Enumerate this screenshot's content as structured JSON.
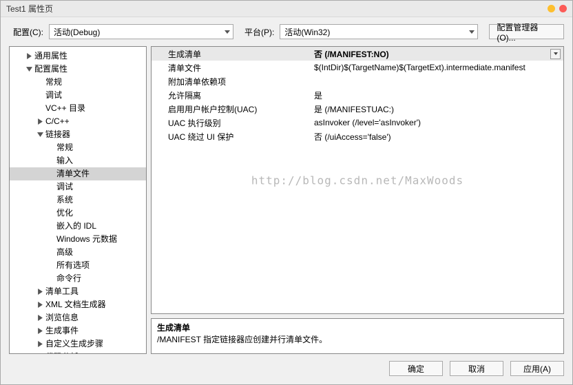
{
  "title": "Test1 属性页",
  "toolbar": {
    "config_label": "配置(C):",
    "config_value": "活动(Debug)",
    "platform_label": "平台(P):",
    "platform_value": "活动(Win32)",
    "manager_button": "配置管理器(O)..."
  },
  "tree": [
    {
      "label": "通用属性",
      "level": 0,
      "toggle": "closed"
    },
    {
      "label": "配置属性",
      "level": 0,
      "toggle": "open"
    },
    {
      "label": "常规",
      "level": 1
    },
    {
      "label": "调试",
      "level": 1
    },
    {
      "label": "VC++ 目录",
      "level": 1
    },
    {
      "label": "C/C++",
      "level": 1,
      "toggle": "closed"
    },
    {
      "label": "链接器",
      "level": 1,
      "toggle": "open"
    },
    {
      "label": "常规",
      "level": 2
    },
    {
      "label": "输入",
      "level": 2
    },
    {
      "label": "清单文件",
      "level": 2,
      "selected": true
    },
    {
      "label": "调试",
      "level": 2
    },
    {
      "label": "系统",
      "level": 2
    },
    {
      "label": "优化",
      "level": 2
    },
    {
      "label": "嵌入的 IDL",
      "level": 2
    },
    {
      "label": "Windows 元数据",
      "level": 2
    },
    {
      "label": "高级",
      "level": 2
    },
    {
      "label": "所有选项",
      "level": 2
    },
    {
      "label": "命令行",
      "level": 2
    },
    {
      "label": "清单工具",
      "level": 1,
      "toggle": "closed"
    },
    {
      "label": "XML 文档生成器",
      "level": 1,
      "toggle": "closed"
    },
    {
      "label": "浏览信息",
      "level": 1,
      "toggle": "closed"
    },
    {
      "label": "生成事件",
      "level": 1,
      "toggle": "closed"
    },
    {
      "label": "自定义生成步骤",
      "level": 1,
      "toggle": "closed"
    },
    {
      "label": "代码分析",
      "level": 1,
      "toggle": "closed"
    }
  ],
  "properties": [
    {
      "name": "生成清单",
      "value": "否 (/MANIFEST:NO)",
      "highlight": true,
      "dropdown": true
    },
    {
      "name": "清单文件",
      "value": "$(IntDir)$(TargetName)$(TargetExt).intermediate.manifest"
    },
    {
      "name": "附加清单依赖项",
      "value": ""
    },
    {
      "name": "允许隔离",
      "value": "是"
    },
    {
      "name": "启用用户帐户控制(UAC)",
      "value": "是 (/MANIFESTUAC:)"
    },
    {
      "name": "UAC 执行级别",
      "value": "asInvoker (/level='asInvoker')"
    },
    {
      "name": "UAC 绕过 UI 保护",
      "value": "否 (/uiAccess='false')"
    }
  ],
  "description": {
    "title": "生成清单",
    "body": "/MANIFEST 指定链接器应创建并行清单文件。"
  },
  "buttons": {
    "ok": "确定",
    "cancel": "取消",
    "apply": "应用(A)"
  },
  "watermark": "http://blog.csdn.net/MaxWoods"
}
